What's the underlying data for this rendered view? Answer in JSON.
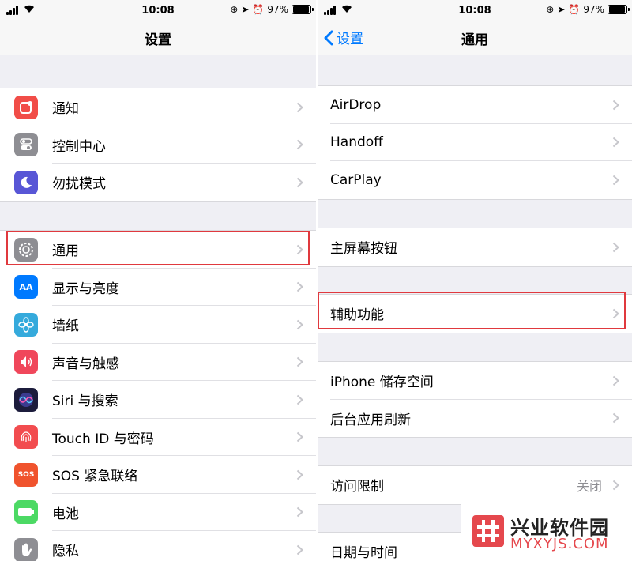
{
  "status": {
    "time": "10:08",
    "battery": "97%",
    "battery_fraction": 0.97
  },
  "left": {
    "title": "设置",
    "groups": [
      {
        "items": [
          {
            "label": "通知",
            "icon": "notifications-icon",
            "color": "#f14d48"
          },
          {
            "label": "控制中心",
            "icon": "control-center-icon",
            "color": "#8e8e93"
          },
          {
            "label": "勿扰模式",
            "icon": "moon-icon",
            "color": "#5856d6"
          }
        ]
      },
      {
        "items": [
          {
            "label": "通用",
            "icon": "gear-icon",
            "color": "#8e8e93"
          },
          {
            "label": "显示与亮度",
            "icon": "display-icon",
            "color": "#007aff",
            "glyph": "AA"
          },
          {
            "label": "墙纸",
            "icon": "wallpaper-icon",
            "color": "#35aadc"
          },
          {
            "label": "声音与触感",
            "icon": "sound-icon",
            "color": "#f0475b"
          },
          {
            "label": "Siri 与搜索",
            "icon": "siri-icon",
            "color": "#1c1c3c"
          },
          {
            "label": "Touch ID 与密码",
            "icon": "fingerprint-icon",
            "color": "#f24c4f"
          },
          {
            "label": "SOS 紧急联络",
            "icon": "sos-icon",
            "color": "#f0532d",
            "glyph": "SOS"
          },
          {
            "label": "电池",
            "icon": "battery-icon",
            "color": "#4cd964"
          },
          {
            "label": "隐私",
            "icon": "hand-icon",
            "color": "#8e8e93"
          }
        ]
      }
    ]
  },
  "right": {
    "back_label": "设置",
    "title": "通用",
    "groups": [
      {
        "items": [
          {
            "label": "AirDrop"
          },
          {
            "label": "Handoff"
          },
          {
            "label": "CarPlay"
          }
        ]
      },
      {
        "items": [
          {
            "label": "主屏幕按钮"
          }
        ]
      },
      {
        "items": [
          {
            "label": "辅助功能"
          }
        ]
      },
      {
        "items": [
          {
            "label": "iPhone 储存空间"
          },
          {
            "label": "后台应用刷新"
          }
        ]
      },
      {
        "items": [
          {
            "label": "访问限制",
            "value": "关闭"
          }
        ]
      },
      {
        "items": [
          {
            "label": "日期与时间"
          }
        ]
      }
    ]
  },
  "watermark": {
    "title": "兴业软件园",
    "url": "MYXYJS.COM"
  },
  "colors": {
    "highlight": "#e0393e",
    "accent": "#007aff",
    "background": "#efeff4"
  }
}
